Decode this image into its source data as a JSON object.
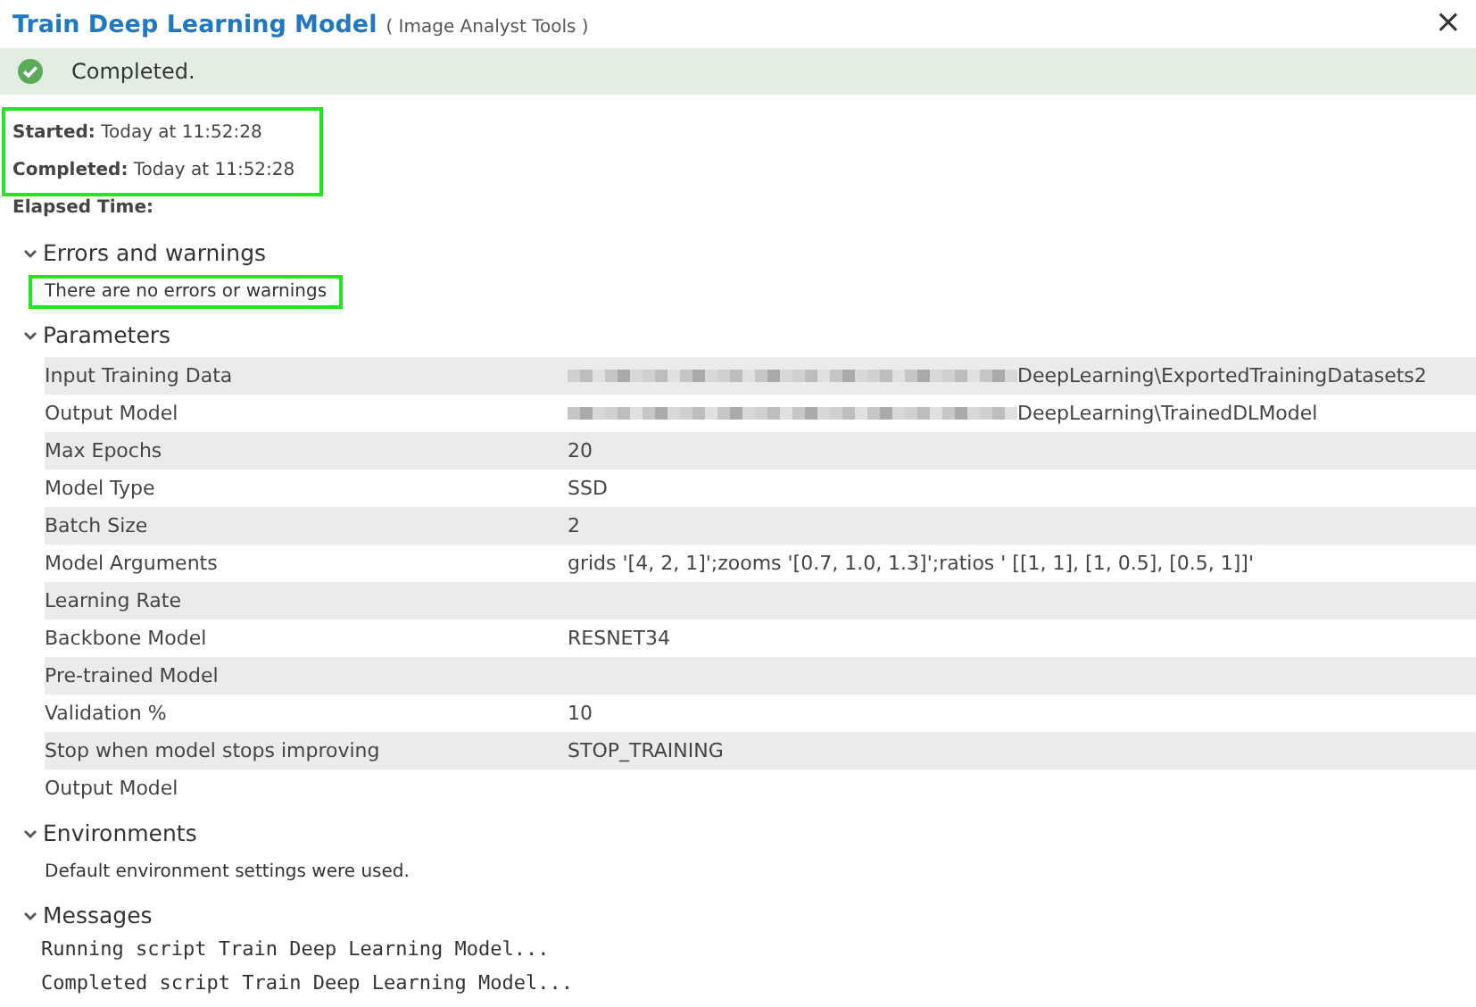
{
  "window": {
    "title": "Train Deep Learning Model",
    "subtitle": "( Image Analyst Tools )",
    "close": "×"
  },
  "status": {
    "text": "Completed.",
    "kind": "success"
  },
  "timing": {
    "highlighted": true,
    "items": [
      {
        "label": "Started:",
        "value": "Today at 11:52:28"
      },
      {
        "label": "Completed:",
        "value": "Today at 11:52:28"
      }
    ]
  },
  "elapsed": {
    "label": "Elapsed Time:"
  },
  "errors": {
    "title": "Errors and warnings",
    "expanded": true,
    "text": "There are no errors or warnings",
    "highlighted": true
  },
  "parameters": {
    "title": "Parameters",
    "expanded": true,
    "rows": [
      {
        "name": "Input Training Data",
        "value": "DeepLearning\\ExportedTrainingDatasets2",
        "blurred_prefix": true
      },
      {
        "name": "Output Model",
        "value": "DeepLearning\\TrainedDLModel",
        "blurred_prefix": true
      },
      {
        "name": "Max Epochs",
        "value": "20",
        "blurred_prefix": false
      },
      {
        "name": "Model Type",
        "value": "SSD",
        "blurred_prefix": false
      },
      {
        "name": "Batch Size",
        "value": "2",
        "blurred_prefix": false
      },
      {
        "name": "Model Arguments",
        "value": "grids '[4, 2, 1]';zooms '[0.7, 1.0, 1.3]';ratios ' [[1, 1], [1, 0.5], [0.5, 1]]'",
        "blurred_prefix": false
      },
      {
        "name": "Learning Rate",
        "blurred_prefix": false
      },
      {
        "name": "Backbone Model",
        "value": "RESNET34",
        "blurred_prefix": false
      },
      {
        "name": "Pre-trained Model",
        "blurred_prefix": false
      },
      {
        "name": "Validation %",
        "value": "10",
        "blurred_prefix": false
      },
      {
        "name": "Stop when model stops improving",
        "value": "STOP_TRAINING",
        "blurred_prefix": false
      },
      {
        "name": "Output Model",
        "blurred_prefix": false
      }
    ]
  },
  "environments": {
    "title": "Environments",
    "expanded": true,
    "text": "Default environment settings were used."
  },
  "messages": {
    "title": "Messages",
    "expanded": true,
    "lines": [
      "Running script Train Deep Learning Model...",
      "Completed script Train Deep Learning Model..."
    ]
  }
}
